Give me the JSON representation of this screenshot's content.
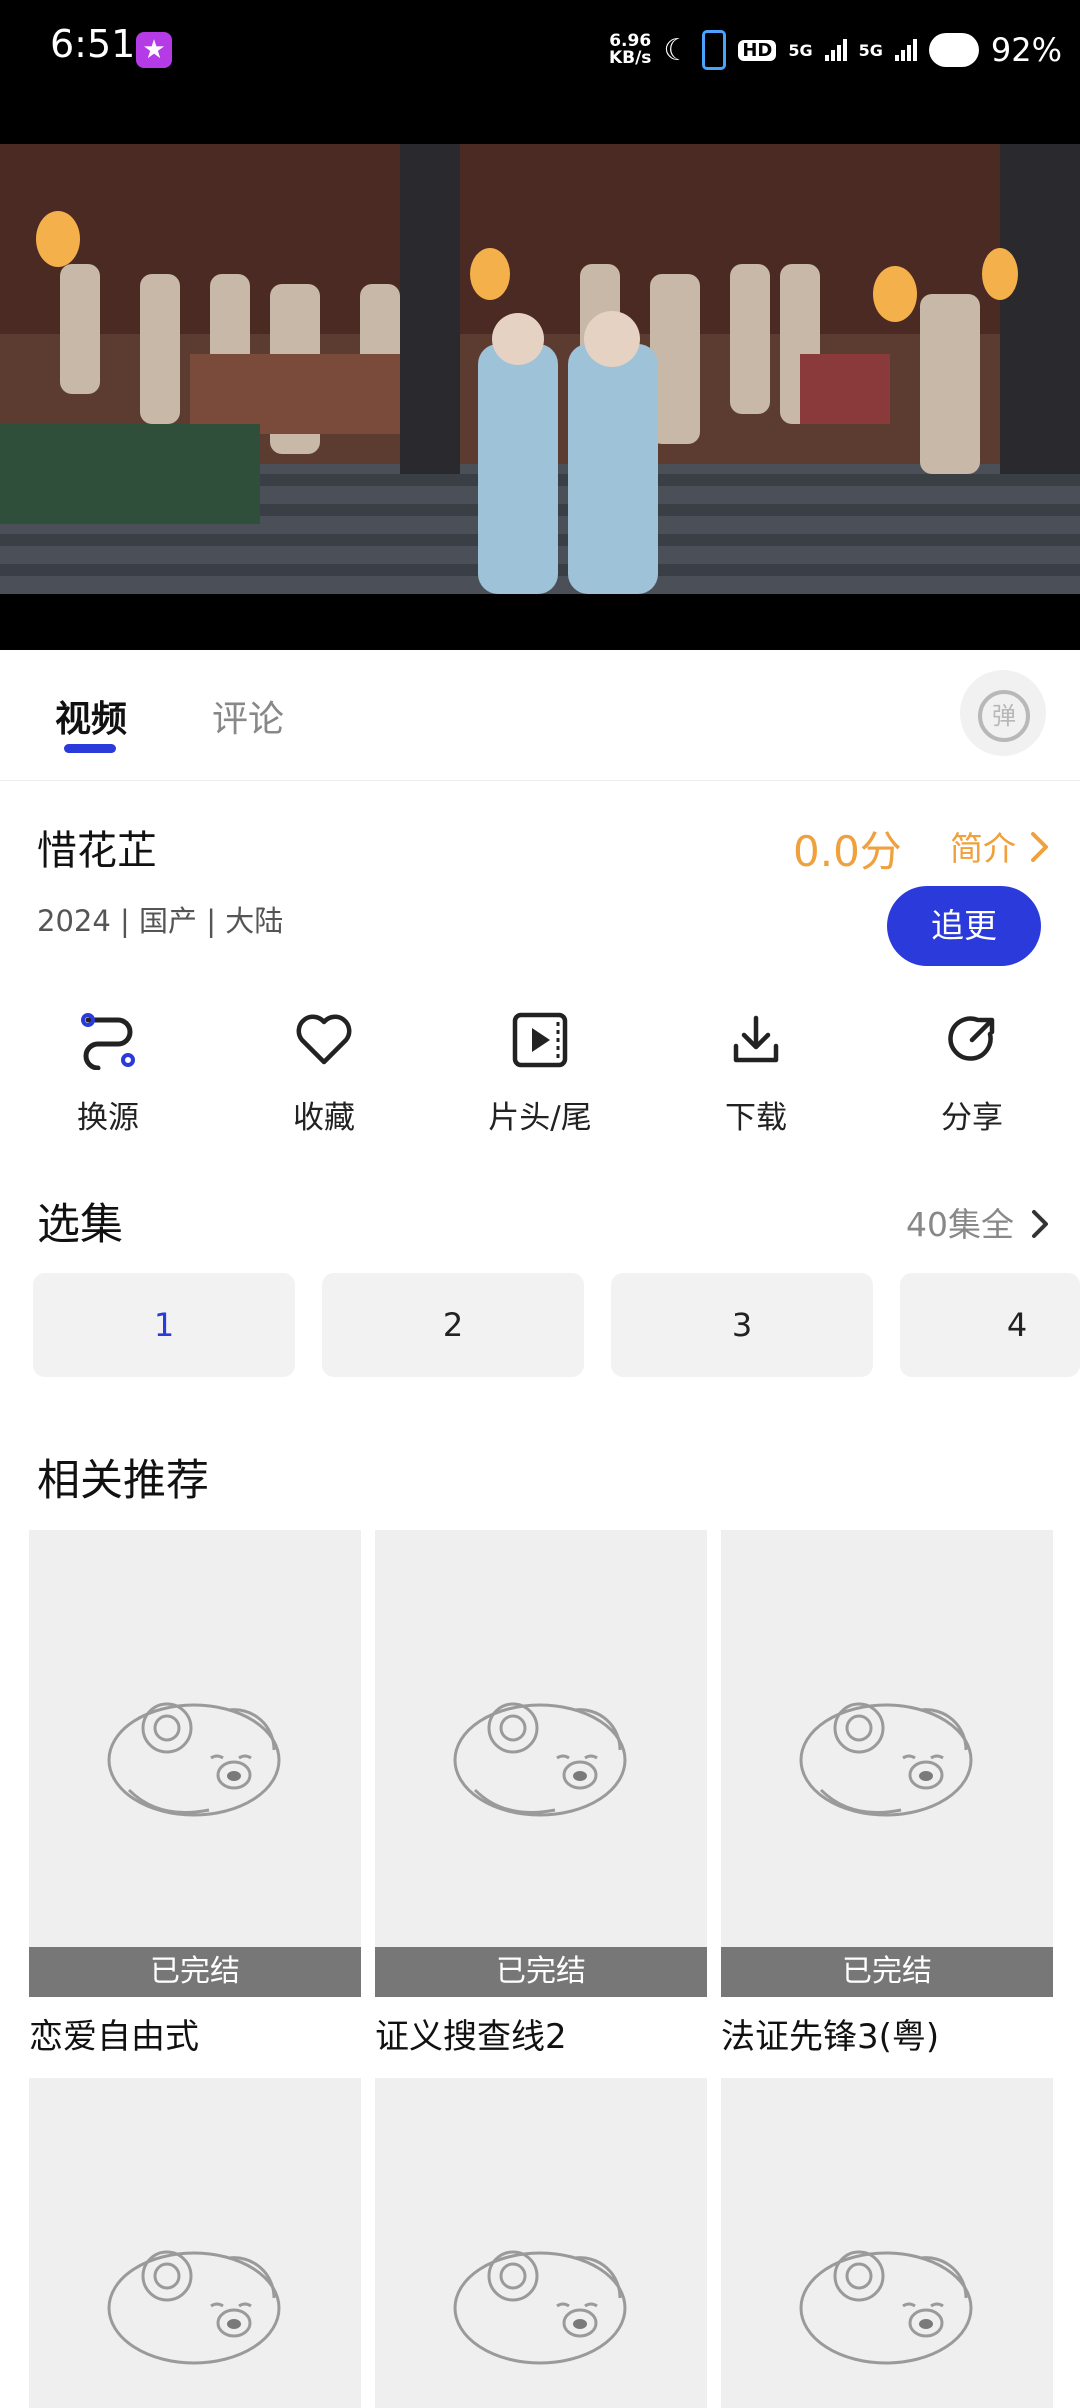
{
  "status_bar": {
    "time": "6:51",
    "net_speed_value": "6.96",
    "net_speed_unit": "KB/s",
    "hd_label": "HD",
    "sim1_label": "5G",
    "sim2_label": "5G",
    "battery": "92%"
  },
  "tabs": [
    {
      "label": "视频"
    },
    {
      "label": "评论"
    }
  ],
  "danmu_label": "弹",
  "show": {
    "title": "惜花芷",
    "meta": "2024 | 国产 | 大陆",
    "score": "0.0分",
    "intro_label": "简介",
    "follow_label": "追更"
  },
  "actions": [
    {
      "label": "换源",
      "icon": "switch-source-icon"
    },
    {
      "label": "收藏",
      "icon": "heart-icon"
    },
    {
      "label": "片头/尾",
      "icon": "play-intro-icon"
    },
    {
      "label": "下载",
      "icon": "download-icon"
    },
    {
      "label": "分享",
      "icon": "share-icon"
    }
  ],
  "episodes": {
    "title": "选集",
    "total": "40集全",
    "items": [
      "1",
      "2",
      "3",
      "4"
    ],
    "selected": "1"
  },
  "recommend": {
    "title": "相关推荐",
    "items": [
      {
        "badge": "已完结",
        "name": "恋爱自由式"
      },
      {
        "badge": "已完结",
        "name": "证义搜查线2"
      },
      {
        "badge": "已完结",
        "name": "法证先锋3(粤)"
      }
    ]
  },
  "colors": {
    "accent": "#2a3adb",
    "score": "#f0a03c"
  }
}
